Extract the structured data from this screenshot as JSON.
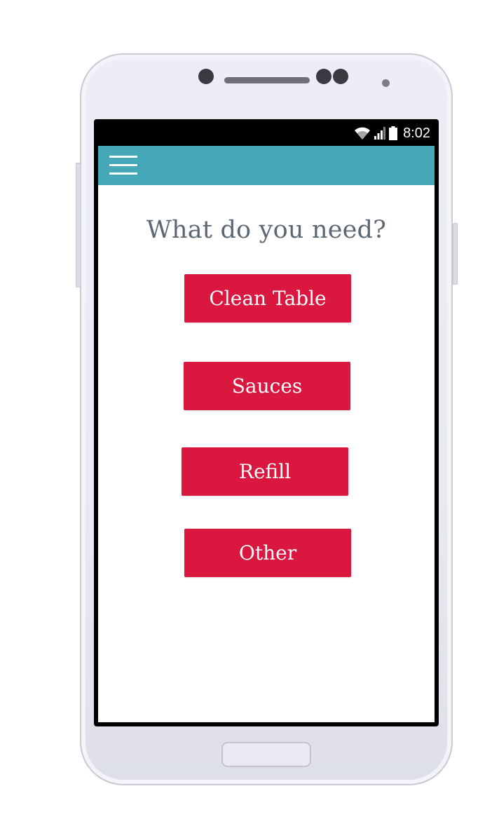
{
  "status_bar": {
    "time": "8:02",
    "icons": [
      "wifi-icon",
      "signal-icon",
      "battery-icon"
    ]
  },
  "toolbar": {
    "menu_icon": "hamburger-menu-icon",
    "color": "#44a8b9"
  },
  "main": {
    "heading": "What do you need?",
    "buttons": [
      {
        "label": "Clean Table"
      },
      {
        "label": "Sauces"
      },
      {
        "label": "Refill"
      },
      {
        "label": "Other"
      }
    ],
    "button_color": "#d9173f",
    "heading_color": "#5c6772"
  }
}
